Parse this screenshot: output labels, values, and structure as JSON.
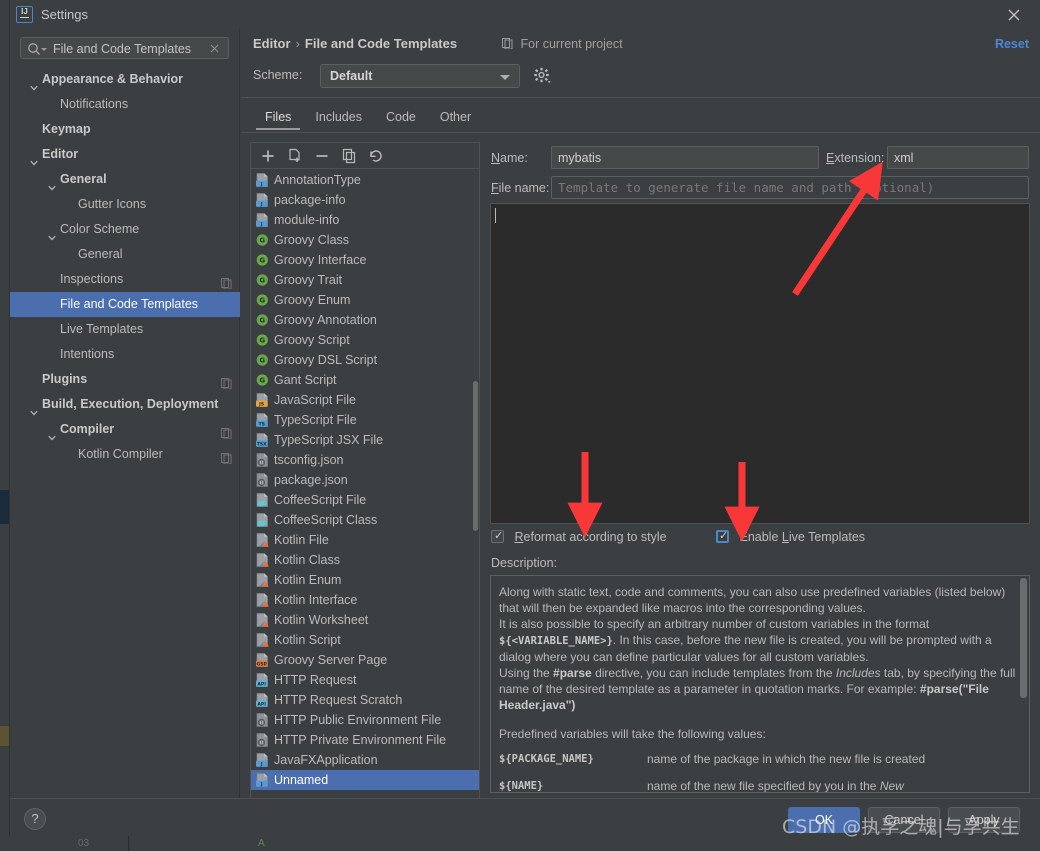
{
  "window": {
    "title": "Settings",
    "app_icon": "intellij-idea-icon",
    "close_icon": "close-icon"
  },
  "sidebar": {
    "search": {
      "value": "File and Code Templates",
      "placeholder": "",
      "icon": "search-icon",
      "clear_icon": "clear-icon"
    },
    "items": [
      {
        "label": "Appearance & Behavior",
        "indent": 0,
        "bold": true,
        "chevron": "expanded",
        "copy": false,
        "selected": false
      },
      {
        "label": "Notifications",
        "indent": 1,
        "bold": false,
        "chevron": "none",
        "copy": false,
        "selected": false
      },
      {
        "label": "Keymap",
        "indent": 0,
        "bold": true,
        "chevron": "none",
        "copy": false,
        "selected": false
      },
      {
        "label": "Editor",
        "indent": 0,
        "bold": true,
        "chevron": "expanded",
        "copy": false,
        "selected": false
      },
      {
        "label": "General",
        "indent": 1,
        "bold": true,
        "chevron": "expanded",
        "copy": false,
        "selected": false
      },
      {
        "label": "Gutter Icons",
        "indent": 2,
        "bold": false,
        "chevron": "none",
        "copy": false,
        "selected": false
      },
      {
        "label": "Color Scheme",
        "indent": 1,
        "bold": false,
        "chevron": "expanded",
        "copy": false,
        "selected": false
      },
      {
        "label": "General",
        "indent": 2,
        "bold": false,
        "chevron": "none",
        "copy": false,
        "selected": false
      },
      {
        "label": "Inspections",
        "indent": 1,
        "bold": false,
        "chevron": "none",
        "copy": true,
        "selected": false
      },
      {
        "label": "File and Code Templates",
        "indent": 1,
        "bold": false,
        "chevron": "none",
        "copy": false,
        "selected": true
      },
      {
        "label": "Live Templates",
        "indent": 1,
        "bold": false,
        "chevron": "none",
        "copy": false,
        "selected": false
      },
      {
        "label": "Intentions",
        "indent": 1,
        "bold": false,
        "chevron": "none",
        "copy": false,
        "selected": false
      },
      {
        "label": "Plugins",
        "indent": 0,
        "bold": true,
        "chevron": "none",
        "copy": true,
        "selected": false
      },
      {
        "label": "Build, Execution, Deployment",
        "indent": 0,
        "bold": true,
        "chevron": "expanded",
        "copy": false,
        "selected": false
      },
      {
        "label": "Compiler",
        "indent": 1,
        "bold": true,
        "chevron": "expanded",
        "copy": true,
        "selected": false
      },
      {
        "label": "Kotlin Compiler",
        "indent": 2,
        "bold": false,
        "chevron": "none",
        "copy": true,
        "selected": false
      }
    ]
  },
  "header": {
    "breadcrumb_root": "Editor",
    "breadcrumb_sep": "›",
    "breadcrumb_current": "File and Code Templates",
    "for_current_project": "For current project",
    "project_icon": "copy-scope-icon",
    "reset_label": "Reset",
    "scheme_label": "Scheme:",
    "scheme_value": "Default",
    "gear_icon": "gear-icon"
  },
  "tabs": [
    {
      "label": "Files",
      "active": true
    },
    {
      "label": "Includes",
      "active": false
    },
    {
      "label": "Code",
      "active": false
    },
    {
      "label": "Other",
      "active": false
    }
  ],
  "list_toolbar": [
    {
      "icon": "add-icon",
      "title": "Add"
    },
    {
      "icon": "add-child-icon",
      "title": "Create Child Template File"
    },
    {
      "icon": "remove-icon",
      "title": "Remove"
    },
    {
      "icon": "copy-icon",
      "title": "Copy"
    },
    {
      "icon": "reset-undo-icon",
      "title": "Reset to Default"
    }
  ],
  "templates": [
    {
      "label": "AnnotationType",
      "icon": "java-file-icon",
      "selected": false
    },
    {
      "label": "package-info",
      "icon": "java-file-icon",
      "selected": false
    },
    {
      "label": "module-info",
      "icon": "java-file-icon",
      "selected": false
    },
    {
      "label": "Groovy Class",
      "icon": "groovy-icon",
      "selected": false
    },
    {
      "label": "Groovy Interface",
      "icon": "groovy-icon",
      "selected": false
    },
    {
      "label": "Groovy Trait",
      "icon": "groovy-icon",
      "selected": false
    },
    {
      "label": "Groovy Enum",
      "icon": "groovy-icon",
      "selected": false
    },
    {
      "label": "Groovy Annotation",
      "icon": "groovy-icon",
      "selected": false
    },
    {
      "label": "Groovy Script",
      "icon": "groovy-icon",
      "selected": false
    },
    {
      "label": "Groovy DSL Script",
      "icon": "groovy-icon",
      "selected": false
    },
    {
      "label": "Gant Script",
      "icon": "groovy-icon",
      "selected": false
    },
    {
      "label": "JavaScript File",
      "icon": "javascript-file-icon",
      "selected": false
    },
    {
      "label": "TypeScript File",
      "icon": "typescript-file-icon",
      "selected": false
    },
    {
      "label": "TypeScript JSX File",
      "icon": "tsx-file-icon",
      "selected": false
    },
    {
      "label": "tsconfig.json",
      "icon": "json-file-icon",
      "selected": false
    },
    {
      "label": "package.json",
      "icon": "json-file-icon",
      "selected": false
    },
    {
      "label": "CoffeeScript File",
      "icon": "coffeescript-icon",
      "selected": false
    },
    {
      "label": "CoffeeScript Class",
      "icon": "coffeescript-icon",
      "selected": false
    },
    {
      "label": "Kotlin File",
      "icon": "kotlin-file-icon",
      "selected": false
    },
    {
      "label": "Kotlin Class",
      "icon": "kotlin-file-icon",
      "selected": false
    },
    {
      "label": "Kotlin Enum",
      "icon": "kotlin-file-icon",
      "selected": false
    },
    {
      "label": "Kotlin Interface",
      "icon": "kotlin-file-icon",
      "selected": false
    },
    {
      "label": "Kotlin Worksheet",
      "icon": "kotlin-file-icon",
      "selected": false
    },
    {
      "label": "Kotlin Script",
      "icon": "kotlin-file-icon",
      "selected": false
    },
    {
      "label": "Groovy Server Page",
      "icon": "gsp-file-icon",
      "selected": false
    },
    {
      "label": "HTTP Request",
      "icon": "http-api-file-icon",
      "selected": false
    },
    {
      "label": "HTTP Request Scratch",
      "icon": "http-api-file-icon",
      "selected": false
    },
    {
      "label": "HTTP Public Environment File",
      "icon": "json-file-icon",
      "selected": false
    },
    {
      "label": "HTTP Private Environment File",
      "icon": "json-file-icon",
      "selected": false
    },
    {
      "label": "JavaFXApplication",
      "icon": "java-file-icon",
      "selected": false
    },
    {
      "label": "Unnamed",
      "icon": "java-file-icon",
      "selected": true
    }
  ],
  "form": {
    "name_label": "Name:",
    "name_accel": "N",
    "name_value": "mybatis",
    "extension_label": "Extension:",
    "extension_accel": "E",
    "extension_value": "xml",
    "file_name_label": "File name:",
    "file_name_accel": "F",
    "file_name_value": "",
    "file_name_placeholder": "Template to generate file name and path (optional)",
    "template_body": "",
    "checkbox_reformat": {
      "label_pre": "",
      "accel": "R",
      "label_post": "eformat according to style",
      "checked": true,
      "focused": false
    },
    "checkbox_live": {
      "label_pre": "Enable ",
      "accel": "L",
      "label_post": "ive Templates",
      "checked": true,
      "focused": true
    },
    "description_label": "Description:"
  },
  "description": {
    "paragraphs": [
      "Along with static text, code and comments, you can also use predefined variables (listed below) that will then be expanded like macros into the corresponding values.",
      "It is also possible to specify an arbitrary number of custom variables in the format ${<VARIABLE_NAME>}. In this case, before the new file is created, you will be prompted with a dialog where you can define particular values for all custom variables.",
      "Using the #parse directive, you can include templates from the Includes tab, by specifying the full name of the desired template as a parameter in quotation marks. For example: #parse(\"File Header.java\")"
    ],
    "variables_intro": "Predefined variables will take the following values:",
    "variables": [
      {
        "name": "${PACKAGE_NAME}",
        "desc": "name of the package in which the new file is created"
      },
      {
        "name": "${NAME}",
        "desc": "name of the new file specified by you in the New <TEMPLATE NAME> dialog"
      }
    ]
  },
  "footer": {
    "help_label": "?",
    "ok_label": "OK",
    "cancel_label": "Cancel",
    "apply_label": "Apply"
  },
  "annotations": {
    "arrow_color": "#f83838",
    "watermark": "CSDN @执孚之魂|与孚共生"
  },
  "ide_background": {
    "line_number": "03",
    "marker": "A"
  },
  "colors": {
    "dialog_bg": "#3c3f41",
    "editor_bg": "#2b2b2b",
    "selection": "#4b6eaf",
    "accent_link": "#4a88d6",
    "text": "#bbbbbb"
  }
}
